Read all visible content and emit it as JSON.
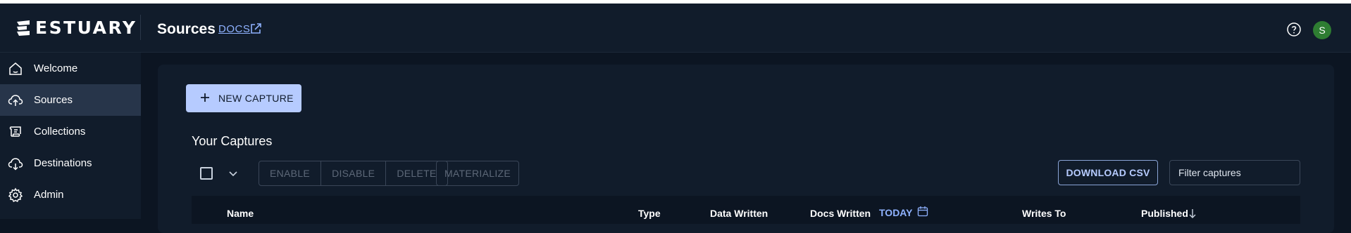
{
  "app": {
    "logo_text": "ESTUARY"
  },
  "header": {
    "title": "Sources",
    "docs_label": "DOCS",
    "avatar_initial": "S"
  },
  "sidebar": {
    "items": [
      {
        "label": "Welcome",
        "icon": "home-icon",
        "active": false
      },
      {
        "label": "Sources",
        "icon": "cloud-upload-icon",
        "active": true
      },
      {
        "label": "Collections",
        "icon": "collection-icon",
        "active": false
      },
      {
        "label": "Destinations",
        "icon": "cloud-download-icon",
        "active": false
      },
      {
        "label": "Admin",
        "icon": "gear-icon",
        "active": false
      }
    ]
  },
  "main": {
    "new_button_label": "NEW CAPTURE",
    "section_title": "Your Captures",
    "actions": {
      "enable": "ENABLE",
      "disable": "DISABLE",
      "delete": "DELETE",
      "materialize": "MATERIALIZE"
    },
    "download_label": "DOWNLOAD CSV",
    "filter_placeholder": "Filter captures"
  },
  "table": {
    "columns": {
      "name": "Name",
      "type": "Type",
      "data_written": "Data Written",
      "docs_written": "Docs Written",
      "range": "TODAY",
      "writes_to": "Writes To",
      "published": "Published"
    }
  },
  "colors": {
    "accent": "#b6cbff",
    "link": "#8fb2ff",
    "background": "#0c1522",
    "surface": "#111c2b",
    "avatar": "#2e7d32"
  }
}
